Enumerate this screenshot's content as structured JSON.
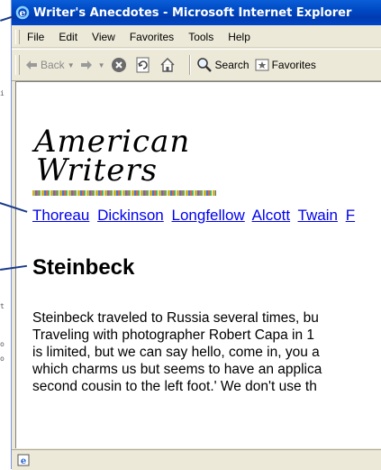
{
  "window": {
    "title": "Writer's Anecdotes - Microsoft Internet Explorer"
  },
  "menu": {
    "items": [
      "File",
      "Edit",
      "View",
      "Favorites",
      "Tools",
      "Help"
    ]
  },
  "toolbar": {
    "back_label": "Back",
    "search_label": "Search",
    "favorites_label": "Favorites"
  },
  "page": {
    "logo_line1": "American",
    "logo_line2": "Writers",
    "nav_links": [
      "Thoreau",
      "Dickinson",
      "Longfellow",
      "Alcott",
      "Twain",
      "F"
    ],
    "heading": "Steinbeck",
    "paragraph_lines": [
      "Steinbeck traveled to Russia several times, bu",
      "Traveling with photographer Robert Capa in 1",
      "is limited, but we can say hello, come in, you a",
      "which charms us but seems to have an applica",
      "second cousin to the left foot.' We don't use th"
    ]
  },
  "colors": {
    "title_bar": "#0049c4",
    "link": "#0000ee",
    "chrome": "#ece9d8"
  },
  "margin_ticks": [
    "i",
    "t",
    "o",
    "o"
  ]
}
